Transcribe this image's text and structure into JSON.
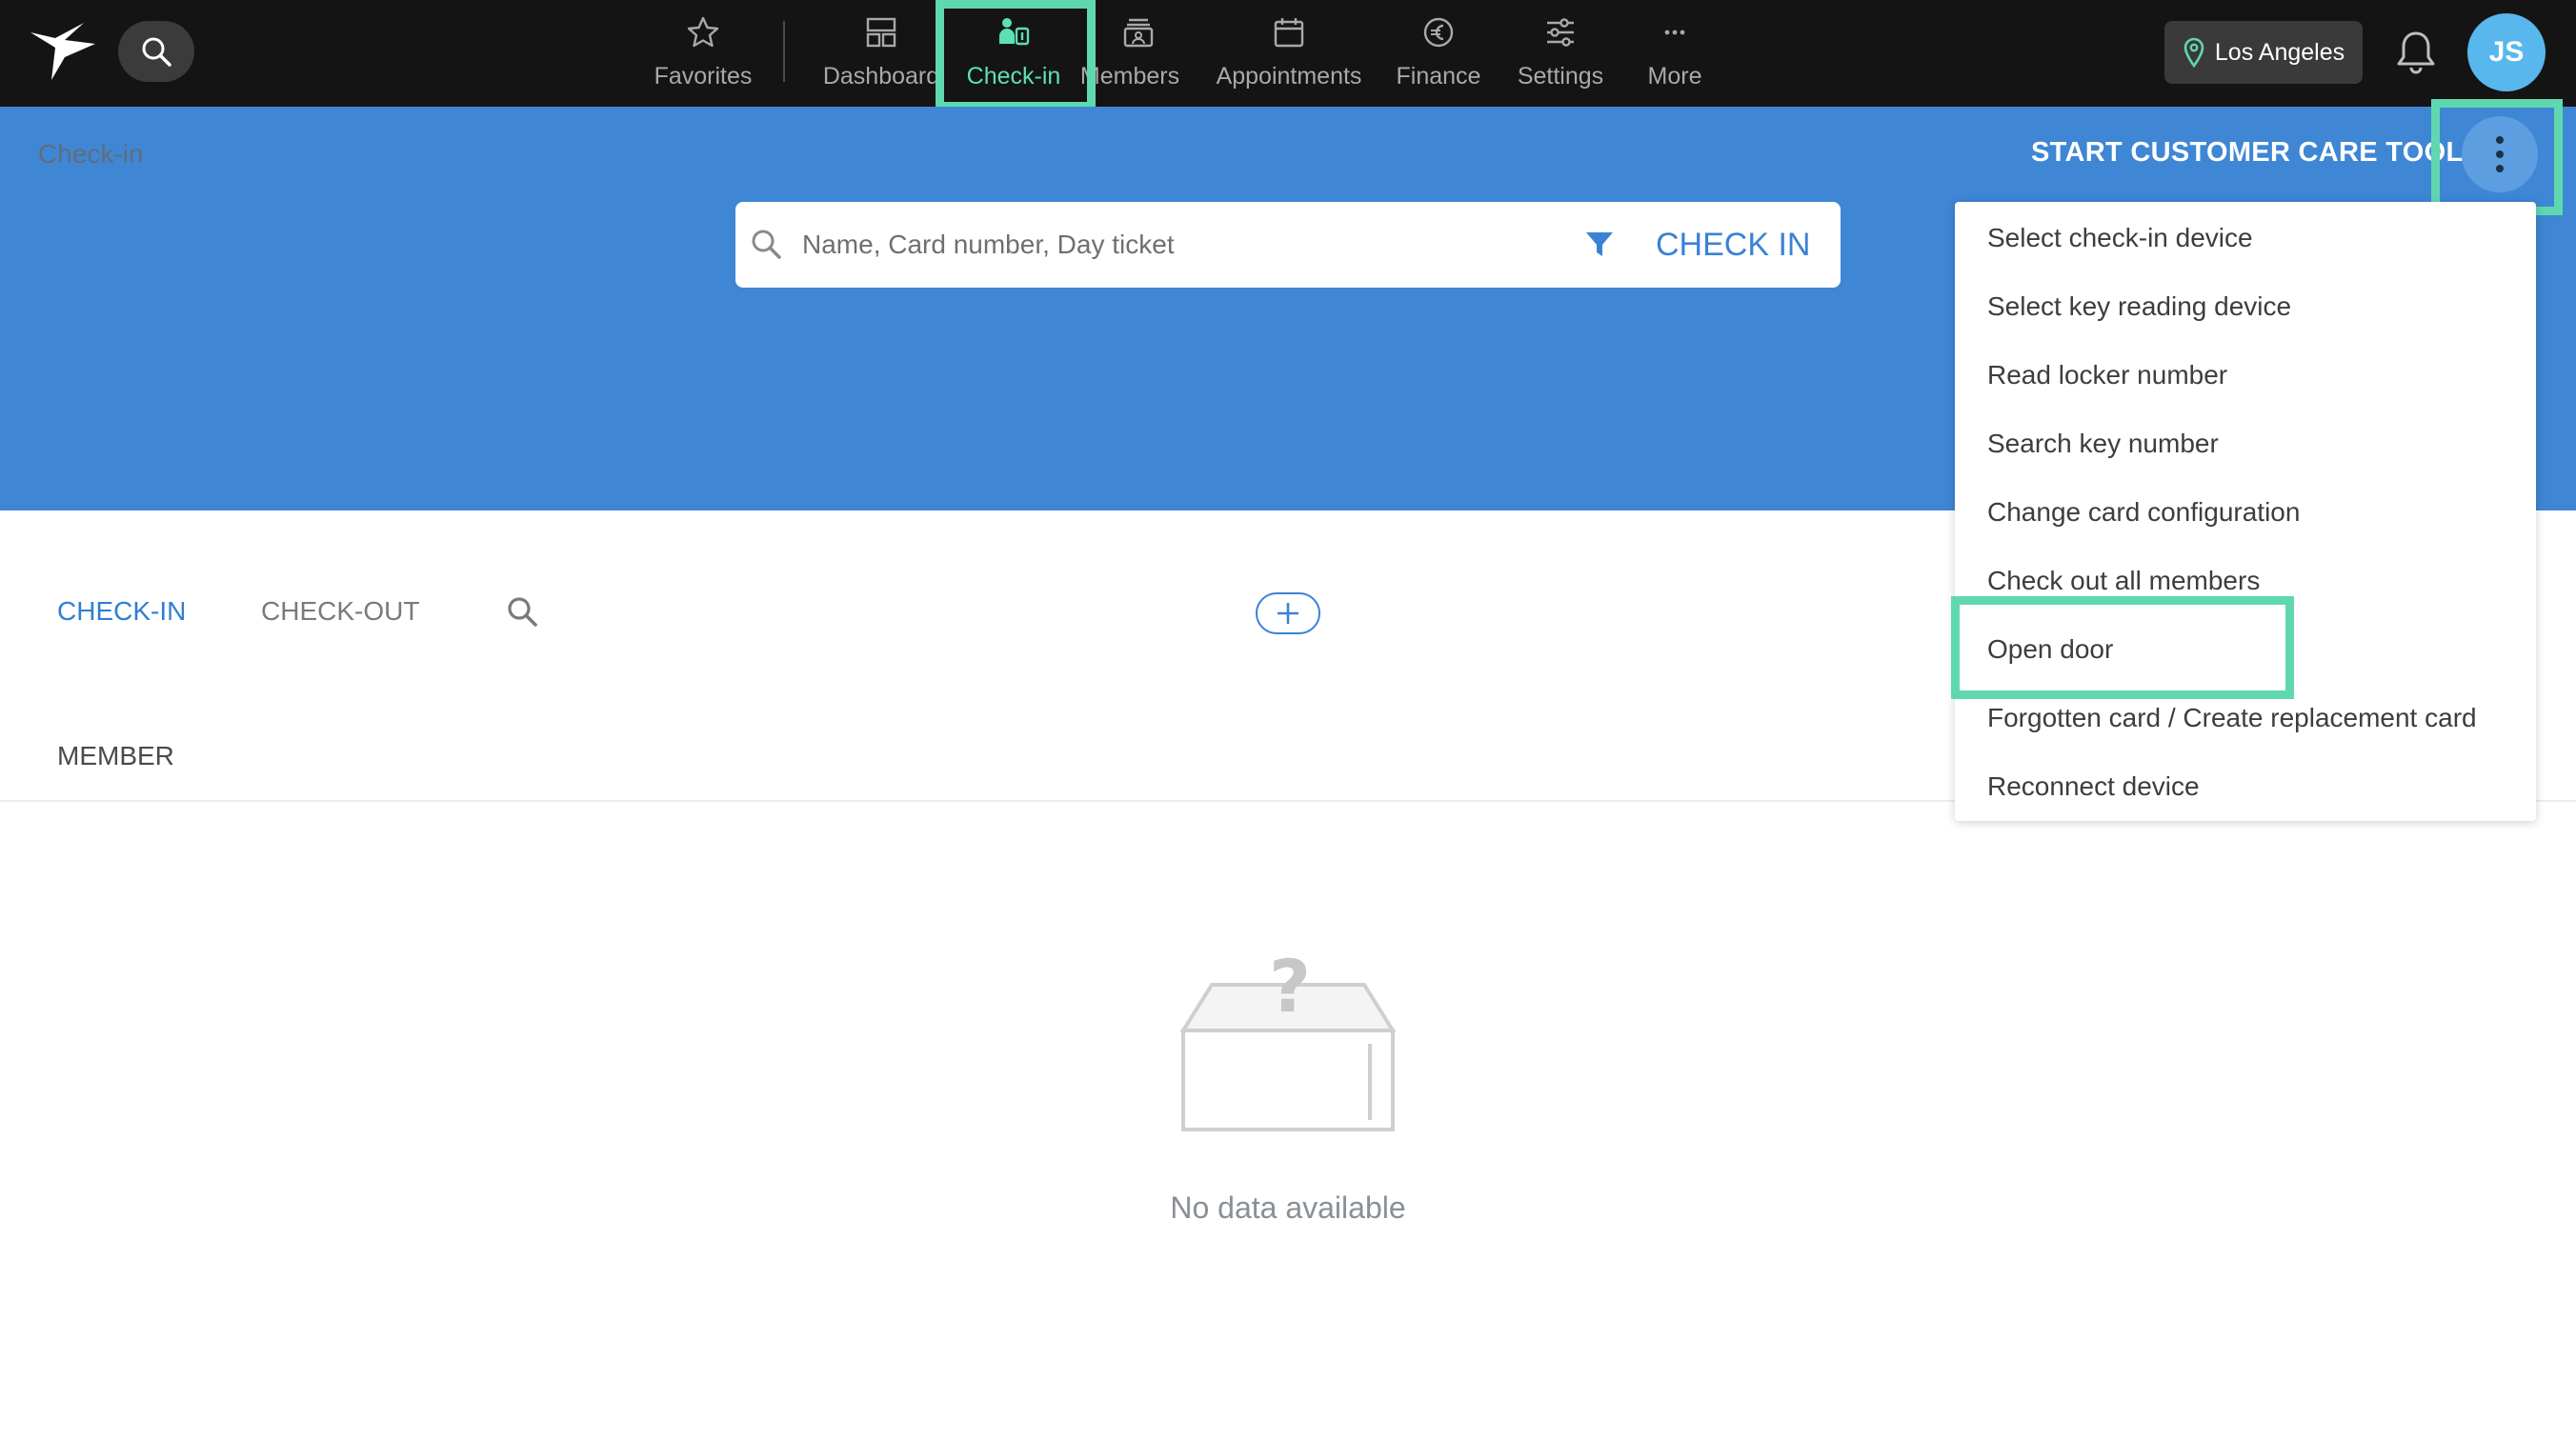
{
  "topbar": {
    "nav": [
      {
        "label": "Favorites",
        "icon": "star-icon"
      },
      {
        "label": "Dashboard",
        "icon": "dashboard-icon"
      },
      {
        "label": "Check-in",
        "icon": "checkin-icon",
        "active": true
      },
      {
        "label": "Members",
        "icon": "members-icon"
      },
      {
        "label": "Appointments",
        "icon": "calendar-icon"
      },
      {
        "label": "Finance",
        "icon": "euro-icon"
      },
      {
        "label": "Settings",
        "icon": "sliders-icon"
      },
      {
        "label": "More",
        "icon": "more-icon"
      }
    ],
    "location": "Los Angeles",
    "avatar_initials": "JS"
  },
  "header": {
    "breadcrumb": "Check-in",
    "care_tool_label": "START CUSTOMER CARE TOOL"
  },
  "search": {
    "placeholder": "Name, Card number, Day ticket",
    "value": "",
    "checkin_label": "CHECK IN"
  },
  "tabs": {
    "checkin": "CHECK-IN",
    "checkout": "CHECK-OUT"
  },
  "table": {
    "column_member": "MEMBER"
  },
  "empty_state": {
    "text": "No data available"
  },
  "menu": {
    "items": [
      "Select check-in device",
      "Select key reading device",
      "Read locker number",
      "Search key number",
      "Change card configuration",
      "Check out all members",
      "Open door",
      "Forgotten card / Create replacement card",
      "Reconnect device"
    ]
  },
  "colors": {
    "topbar_bg": "#141414",
    "header_blue": "#3f86d5",
    "accent_blue": "#3a82d6",
    "highlight_green": "#5fd8b0",
    "active_nav": "#5de0b4",
    "avatar_bg": "#58b7ec"
  }
}
